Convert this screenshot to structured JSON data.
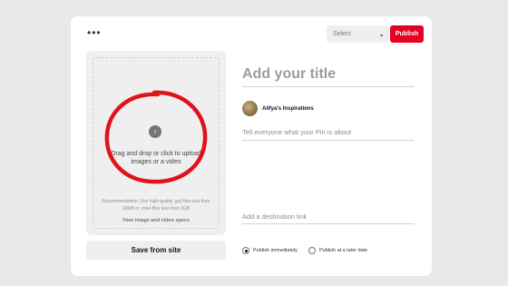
{
  "header": {
    "more_icon": "more-horizontal-icon",
    "more_glyph": "•••",
    "select_value": "Select",
    "publish_label": "Publish"
  },
  "upload": {
    "icon": "arrow-up-circle-icon",
    "icon_glyph": "↑",
    "drag_text": "Drag and drop or click to upload images or a video",
    "recommendation": "Recommendation: Use high-quality .jpg files less than 32MB or .mp4 files less than 2GB",
    "spec_link": "View image and video specs",
    "annotation_color": "#e0121b"
  },
  "save_site_label": "Save from site",
  "form": {
    "title_placeholder": "Add your title",
    "board_name": "Alifya's Inspirations",
    "description_placeholder": "Tell everyone what your Pin is about",
    "link_placeholder": "Add a destination link"
  },
  "publish_options": [
    {
      "label": "Publish immediately",
      "selected": true
    },
    {
      "label": "Publish at a later date",
      "selected": false
    }
  ],
  "colors": {
    "accent": "#e60023",
    "background": "#e9e9e9",
    "card": "#ffffff"
  }
}
